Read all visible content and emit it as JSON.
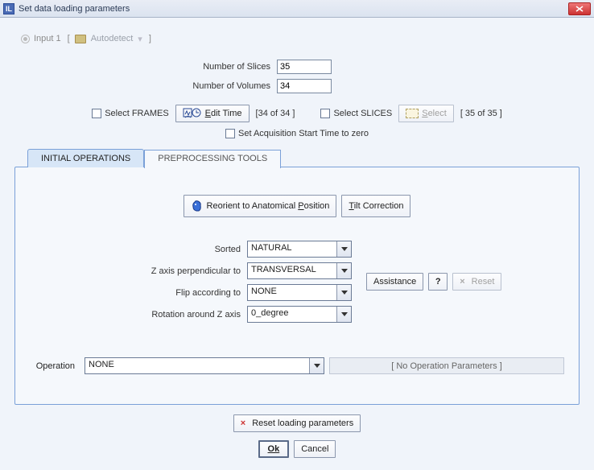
{
  "titlebar": {
    "title": "Set  data loading parameters"
  },
  "input": {
    "label": "Input 1",
    "autodetect": "Autodetect"
  },
  "fields": {
    "slices_label": "Number of Slices",
    "slices_value": "35",
    "volumes_label": "Number of Volumes",
    "volumes_value": "34"
  },
  "frames": {
    "select_frames": "Select FRAMES",
    "edit_time": "Edit Time",
    "edit_count": "[34 of 34 ]",
    "select_slices": "Select SLICES",
    "select_btn": "Select",
    "slice_count": "[ 35 of 35 ]"
  },
  "acq": {
    "label": "Set Acquisition Start Time to zero"
  },
  "tabs": {
    "initial": "INITIAL OPERATIONS",
    "preproc": "PREPROCESSING TOOLS"
  },
  "reorient": {
    "label": "Reorient to Anatomical Position"
  },
  "tilt": {
    "label": "Tilt Correction"
  },
  "params": {
    "sorted_label": "Sorted",
    "sorted_value": "NATURAL",
    "zaxis_label": "Z axis perpendicular to",
    "zaxis_value": "TRANSVERSAL",
    "flip_label": "Flip according to",
    "flip_value": "NONE",
    "rot_label": "Rotation around Z axis",
    "rot_value": "0_degree"
  },
  "assist": {
    "label": "Assistance",
    "q": "?",
    "reset": "Reset"
  },
  "operation": {
    "label": "Operation",
    "value": "NONE",
    "noop": "[ No Operation Parameters ]"
  },
  "reset_loading": {
    "label": "Reset loading parameters"
  },
  "footer": {
    "ok": "Ok",
    "cancel": "Cancel"
  }
}
